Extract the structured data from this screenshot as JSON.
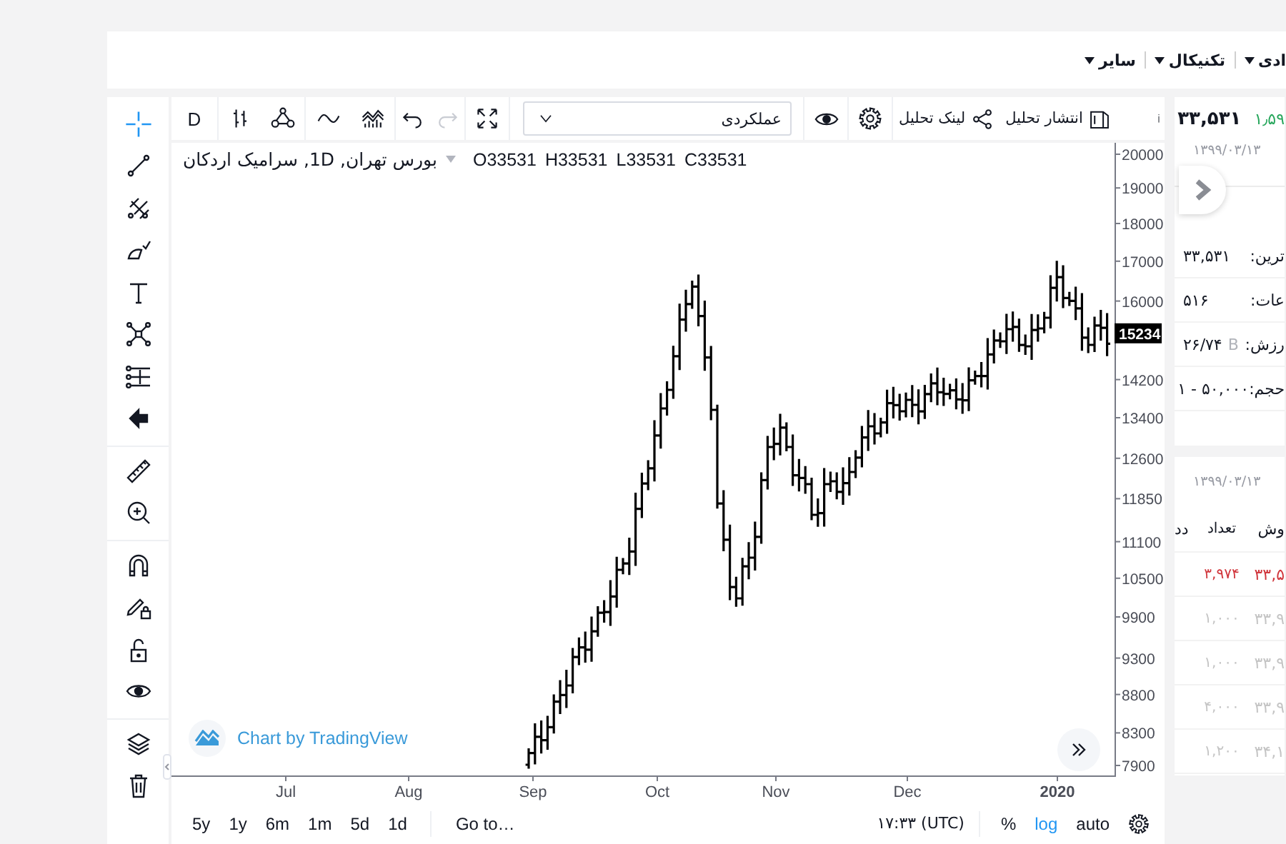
{
  "header": {
    "menu": [
      {
        "label": "ادی"
      },
      {
        "label": "تکنیکال"
      },
      {
        "label": "سایر"
      }
    ]
  },
  "chart_widget": {
    "tool_groups": [
      [
        {
          "kind": "crosshair",
          "selected": true
        },
        {
          "kind": "trend-line",
          "selected": false
        },
        {
          "kind": "pitchfork",
          "selected": false
        },
        {
          "kind": "brush",
          "selected": false
        },
        {
          "kind": "text",
          "selected": false
        },
        {
          "kind": "pattern",
          "selected": false
        },
        {
          "kind": "projection",
          "selected": false
        },
        {
          "kind": "back-arrow",
          "selected": false
        }
      ],
      [
        {
          "kind": "ruler",
          "selected": false
        },
        {
          "kind": "zoom-in",
          "selected": false
        }
      ],
      [
        {
          "kind": "magnet",
          "selected": false
        },
        {
          "kind": "lock-drawings",
          "selected": false
        },
        {
          "kind": "unlock",
          "selected": false
        },
        {
          "kind": "eye",
          "selected": false
        }
      ],
      [
        {
          "kind": "layers",
          "selected": false
        },
        {
          "kind": "trash",
          "selected": false
        }
      ]
    ],
    "top_toolbar": {
      "interval": "D",
      "history": [
        {
          "kind": "undo",
          "disabled": false
        },
        {
          "kind": "redo",
          "disabled": true
        }
      ],
      "layout_select": {
        "value": "عملکردی"
      },
      "actions": [
        {
          "kind": "publish",
          "label": "انتشار تحلیل"
        },
        {
          "kind": "share",
          "label": "لینک تحلیل"
        }
      ]
    },
    "legend": {
      "symbol": "بورس تهران, 1D, سرامیک اردکان",
      "ohlc": [
        "C33531",
        "L33531",
        "H33531",
        "O33531"
      ]
    },
    "price_axis": {
      "labels": [
        "20000",
        "19000",
        "18000",
        "17000",
        "16000",
        "14200",
        "13400",
        "12600",
        "11850",
        "11100",
        "10500",
        "9900",
        "9300",
        "8800",
        "8300",
        "7900"
      ],
      "last_price": "15234"
    },
    "time_axis": {
      "labels": [
        {
          "text": "2020",
          "kind": "year"
        },
        {
          "text": "Dec",
          "kind": "month"
        },
        {
          "text": "Nov",
          "kind": "month"
        },
        {
          "text": "Oct",
          "kind": "month"
        },
        {
          "text": "Sep",
          "kind": "month"
        },
        {
          "text": "Aug",
          "kind": "month"
        },
        {
          "text": "Jul",
          "kind": "month"
        }
      ]
    },
    "attribution": "Chart by TradingView",
    "bottom_bar": {
      "ranges": [
        "1d",
        "5d",
        "1m",
        "6m",
        "1y",
        "5y"
      ],
      "goto": "Go to…",
      "clock": "۱۷:۳۳ (UTC)",
      "scale_toggles": [
        {
          "label": "auto",
          "on": false
        },
        {
          "label": "log",
          "on": true
        },
        {
          "label": "%",
          "on": false
        }
      ]
    }
  },
  "side_panel": {
    "quote": {
      "change": "۱٫۵۹",
      "price": "۳۳,۵۳۱",
      "date": "۱۳۹۹/۰۳/۱۳",
      "rows": [
        {
          "label": "ترین:",
          "value": "۳۳,۵۳۱"
        },
        {
          "label": "عات:",
          "value": "۵۱۶"
        },
        {
          "label": "رزش:",
          "value": "۲۶/۷۴",
          "unit": "B"
        },
        {
          "label": "حجم:",
          "value": "۱ - ۵۰,۰۰۰"
        }
      ]
    },
    "trades": {
      "date": "۱۳۹۹/۰۳/۱۳",
      "columns": [
        "وش",
        "تعداد",
        "دد"
      ],
      "rows": [
        {
          "price": "۳۳,۵",
          "count": "۳,۹۷۴",
          "color": "#d0343a"
        },
        {
          "price": "۳۳,۹",
          "count": "۱,۰۰۰",
          "color": "#c4c4c4"
        },
        {
          "price": "۳۳,۹",
          "count": "۱,۰۰۰",
          "color": "#c4c4c4"
        },
        {
          "price": "۳۳,۹",
          "count": "۴,۰۰۰",
          "color": "#c4c4c4"
        },
        {
          "price": "۳۴,۱",
          "count": "۱,۲۰۰",
          "color": "#c4c4c4"
        }
      ]
    }
  }
}
